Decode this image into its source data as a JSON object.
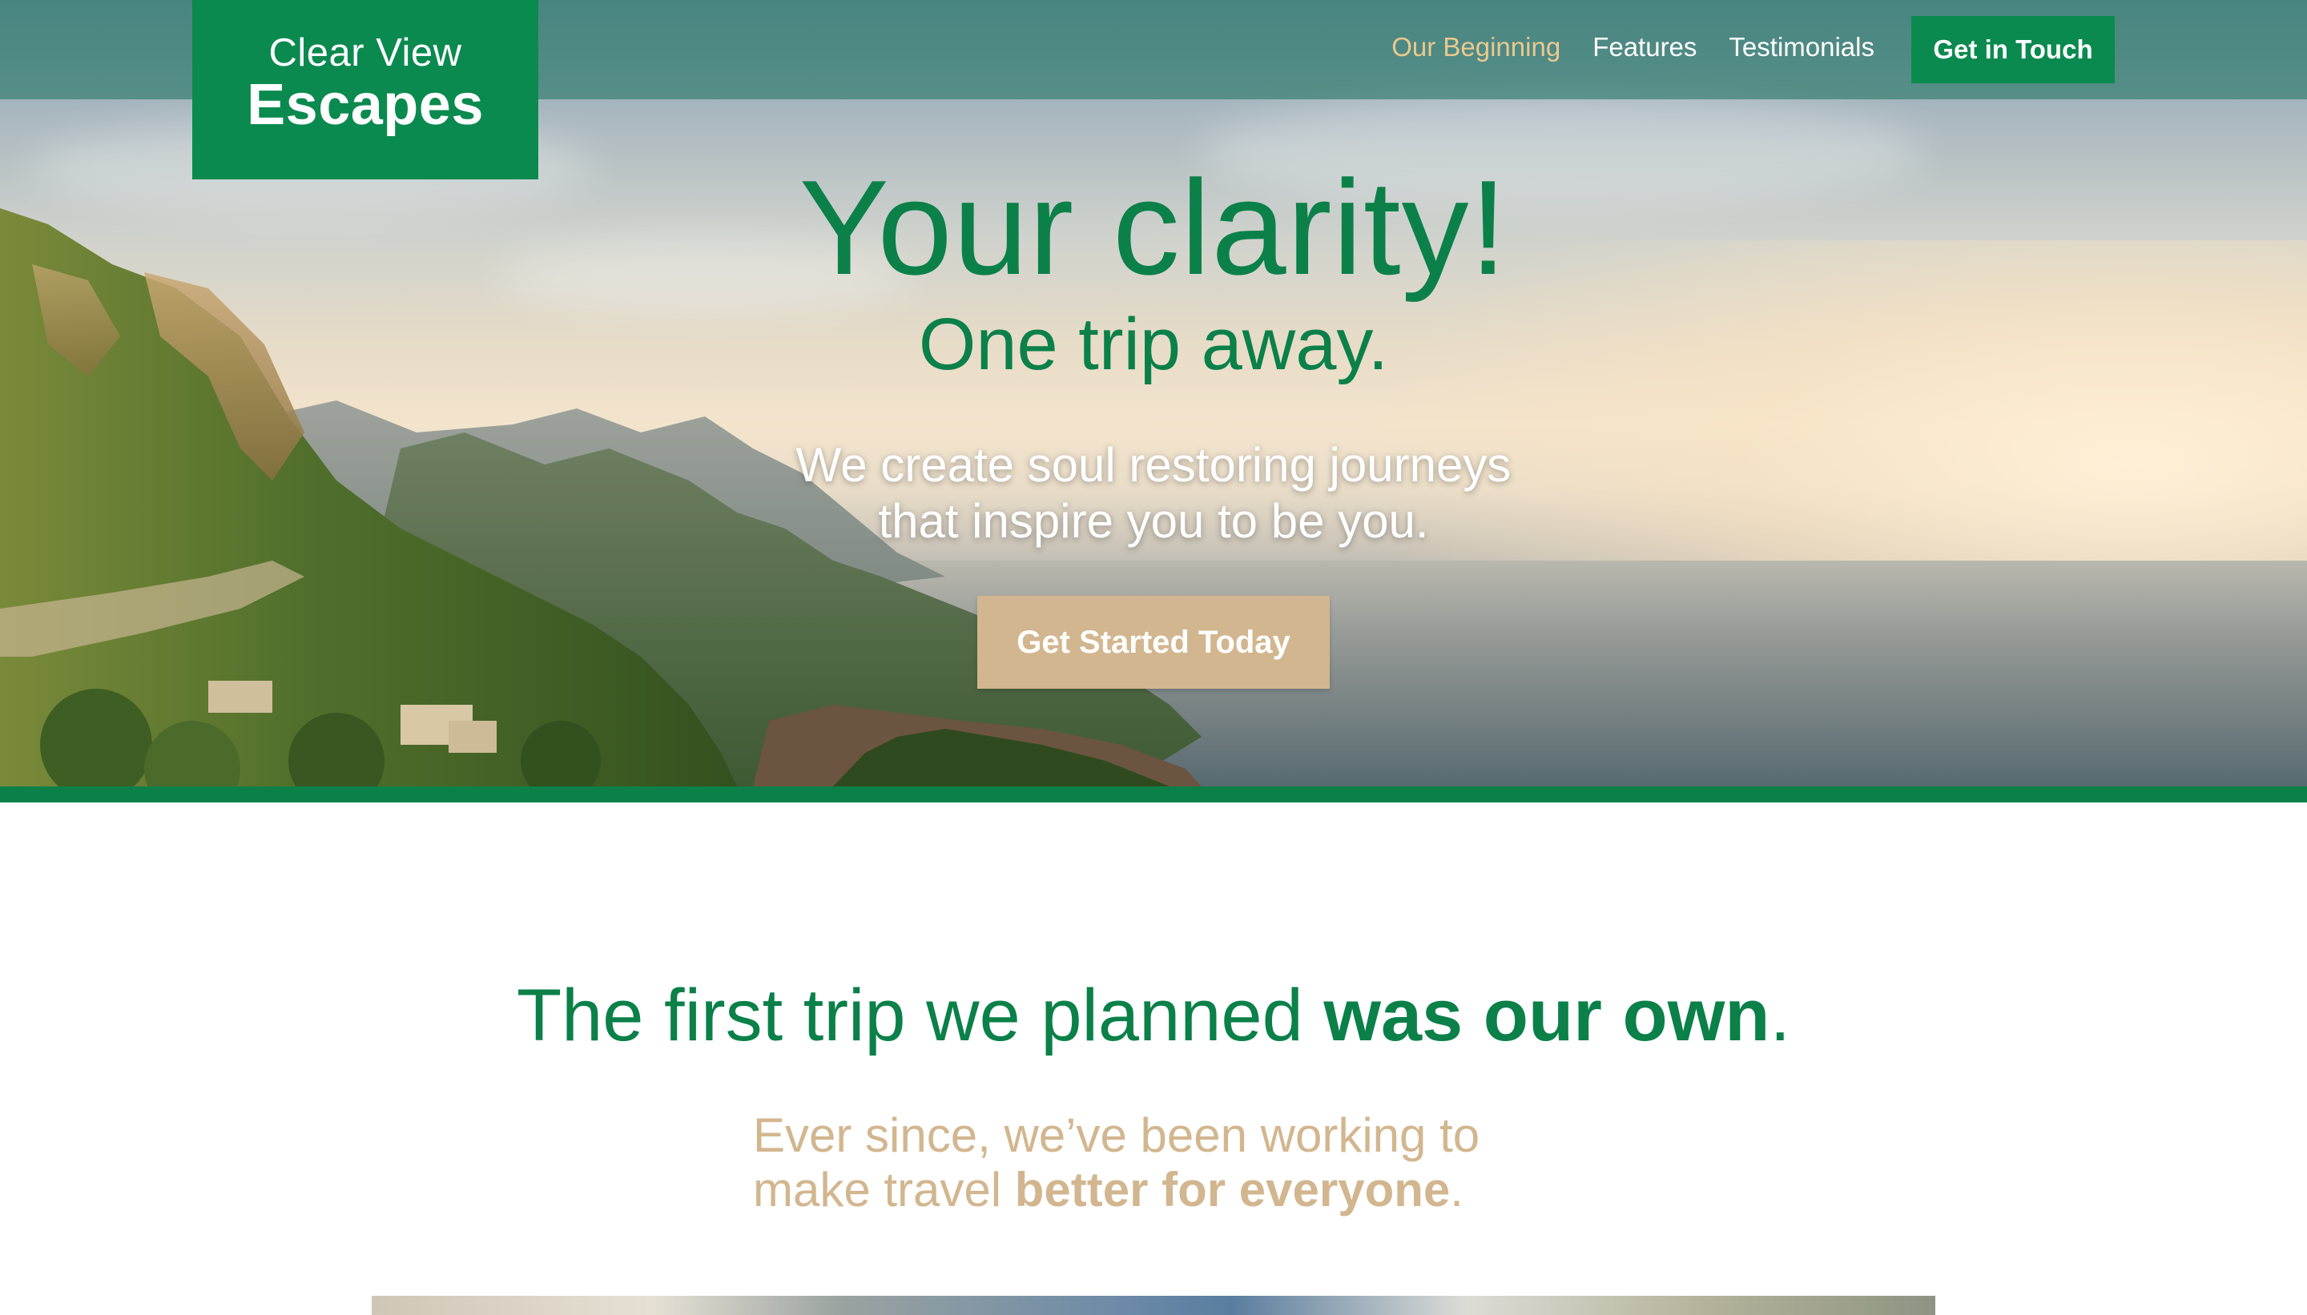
{
  "brand": {
    "line1": "Clear View",
    "line2": "Escapes",
    "color": "#0b8a4f"
  },
  "nav": {
    "items": [
      {
        "label": "Our Beginning",
        "active": true
      },
      {
        "label": "Features",
        "active": false
      },
      {
        "label": "Testimonials",
        "active": false
      }
    ],
    "cta": "Get in Touch"
  },
  "hero": {
    "title": "Your clarity!",
    "subtitle": "One trip away.",
    "description_line1": "We create soul restoring journeys",
    "description_line2": "that inspire you to be you.",
    "cta": "Get Started Today",
    "background": "coastal-cliffs-sea-photo",
    "accent_color": "#0b8049",
    "cta_color": "#d2b68f"
  },
  "story": {
    "heading_regular": "The first trip we planned ",
    "heading_bold": "was our own",
    "heading_end": ".",
    "text_line1": "Ever since, we’ve been working to",
    "text_line2_regular": "make travel ",
    "text_line2_bold": "better for everyone",
    "text_line2_end": "."
  }
}
